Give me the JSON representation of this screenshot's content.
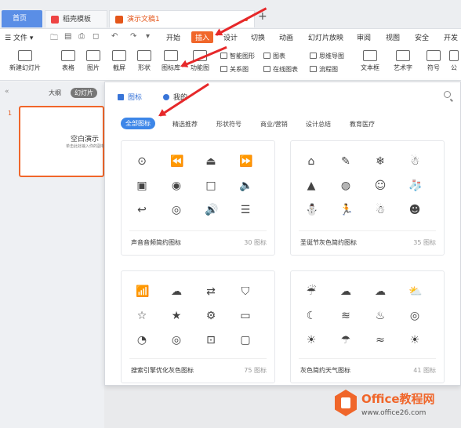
{
  "tabs": {
    "home": "首页",
    "template": "稻壳模板",
    "document": "演示文稿1"
  },
  "menu": {
    "file": "文件",
    "items": [
      "开始",
      "插入",
      "设计",
      "切换",
      "动画",
      "幻灯片放映",
      "审阅",
      "视图",
      "安全",
      "开发"
    ]
  },
  "toolbar": {
    "new_slide": "新建幻灯片",
    "table": "表格",
    "picture": "图片",
    "screenshot": "截屏",
    "shape": "形状",
    "icon_library": "图标库",
    "function_chart": "功能图",
    "smart_graphic": "智能图形",
    "chart": "图表",
    "mind_map": "思维导图",
    "relation_chart": "关系图",
    "online_chart": "在线图表",
    "flowchart": "流程图",
    "textbox": "文本框",
    "art_text": "艺术字",
    "symbol": "符号",
    "formula": "公"
  },
  "left_panel": {
    "tab_outline": "大纲",
    "tab_slides": "幻灯片",
    "slide_number": "1",
    "thumb_title": "空白演示",
    "thumb_subtitle": "单击此处输入你的副标题"
  },
  "icon_panel": {
    "tab_icons": "图标",
    "tab_mine": "我的",
    "categories": [
      "全部图标",
      "精选推荐",
      "形状符号",
      "商业/营销",
      "设计总结",
      "教育医疗"
    ],
    "cards": [
      {
        "name": "声音音频简约图标",
        "count": "30 图标",
        "icons": [
          "⊙",
          "⏪",
          "⏏",
          "⏩",
          "▣",
          "◉",
          "□",
          "🔈",
          "↩",
          "◎",
          "🔊",
          "☰"
        ]
      },
      {
        "name": "圣诞节灰色简约图标",
        "count": "35 图标",
        "icons": [
          "⌂",
          "✎",
          "❄",
          "☃",
          "▲",
          "◍",
          "☺",
          "🧦",
          "⛄",
          "🏃",
          "☃",
          "☻"
        ]
      },
      {
        "name": "搜索引擎优化灰色图标",
        "count": "75 图标",
        "icons": [
          "📶",
          "☁",
          "⇄",
          "⛉",
          "☆",
          "★",
          "⚙",
          "▭",
          "◔",
          "◎",
          "⊡",
          "▢"
        ]
      },
      {
        "name": "灰色简约天气图标",
        "count": "41 图标",
        "icons": [
          "☔",
          "☁",
          "☁",
          "⛅",
          "☾",
          "≋",
          "♨",
          "◎",
          "☀",
          "☂",
          "≈",
          "☀"
        ]
      }
    ]
  },
  "watermark": {
    "line1": "Office教程网",
    "line2": "www.office26.com"
  }
}
